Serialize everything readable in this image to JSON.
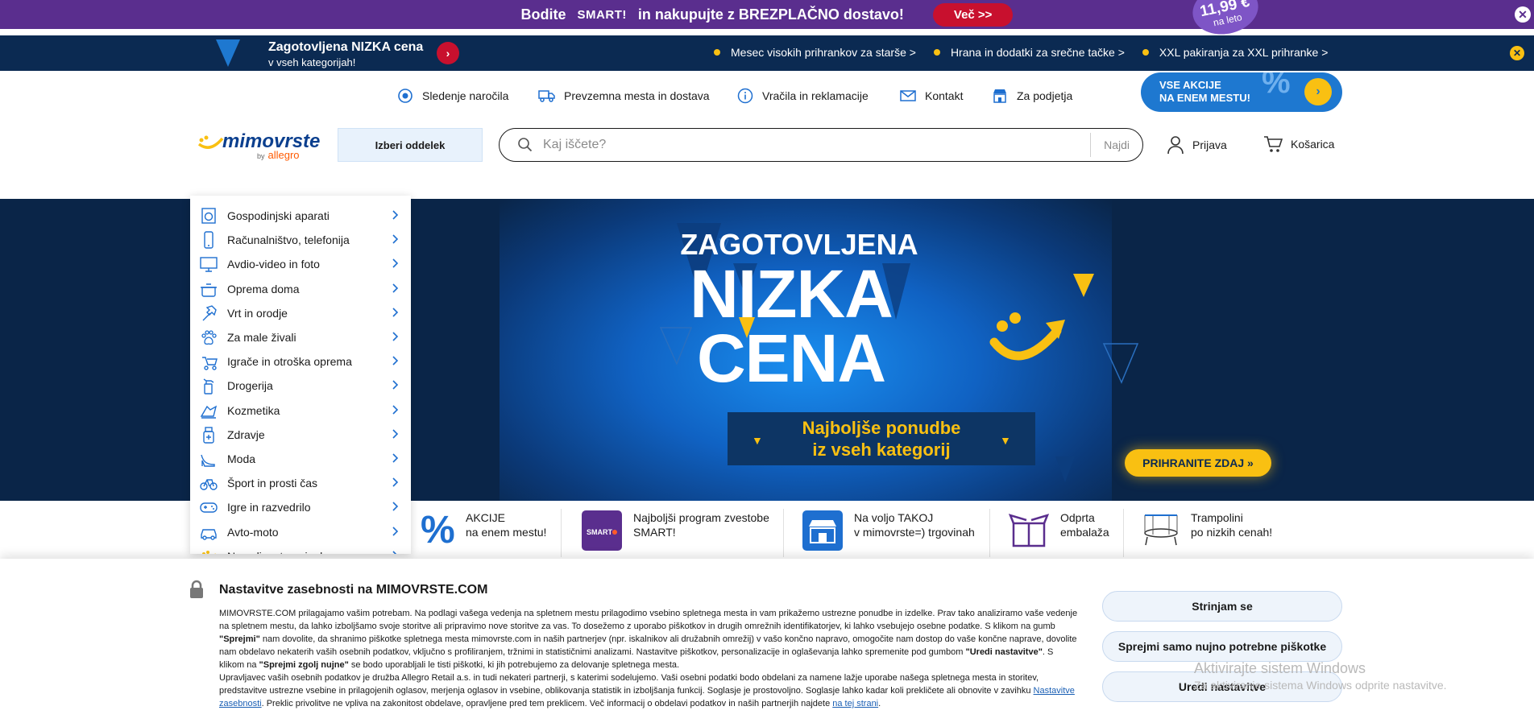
{
  "topbar": {
    "text_before": "Bodite",
    "smart_logo": "SMART!",
    "text_after": "in nakupujte z BREZPLAČNO dostavo!",
    "more_button": "Več >>",
    "badge_price": "11,99 €",
    "badge_sub": "na leto",
    "colors": {
      "background": "#5a2e8e",
      "button": "#c8102e"
    }
  },
  "secondary_bar": {
    "title": "Zagotovljena NIZKA cena",
    "subtitle": "v vseh kategorijah!",
    "links": [
      "Mesec visokih prihrankov za starše >",
      "Hrana in dodatki za srečne tačke >",
      "XXL pakiranja za XXL prihranke >"
    ],
    "colors": {
      "background": "#0b2a52",
      "bullet": "#f9c012"
    }
  },
  "utility_nav": [
    {
      "icon": "location-target-icon",
      "label": "Sledenje naročila"
    },
    {
      "icon": "truck-icon",
      "label": "Prevzemna mesta in dostava"
    },
    {
      "icon": "info-icon",
      "label": "Vračila in reklamacije"
    },
    {
      "icon": "envelope-icon",
      "label": "Kontakt"
    },
    {
      "icon": "shop-icon",
      "label": "Za podjetja"
    }
  ],
  "promo_pill": {
    "line1": "VSE AKCIJE",
    "line2": "NA ENEM MESTU!",
    "symbol": "%"
  },
  "header": {
    "logo_word": "mimovrste",
    "logo_by": "by",
    "logo_brand": "allegro",
    "department_button": "Izberi oddelek",
    "search_placeholder": "Kaj iščete?",
    "search_button": "Najdi",
    "login": "Prijava",
    "cart": "Košarica"
  },
  "categories": [
    {
      "icon": "washing-machine-icon",
      "label": "Gospodinjski aparati"
    },
    {
      "icon": "smartphone-icon",
      "label": "Računalništvo, telefonija"
    },
    {
      "icon": "monitor-icon",
      "label": "Avdio-video in foto"
    },
    {
      "icon": "pot-icon",
      "label": "Oprema doma"
    },
    {
      "icon": "hammer-icon",
      "label": "Vrt in orodje"
    },
    {
      "icon": "paw-icon",
      "label": "Za male živali"
    },
    {
      "icon": "stroller-icon",
      "label": "Igrače in otroška oprema"
    },
    {
      "icon": "spray-bottle-icon",
      "label": "Drogerija"
    },
    {
      "icon": "cosmetics-icon",
      "label": "Kozmetika"
    },
    {
      "icon": "medicine-icon",
      "label": "Zdravje"
    },
    {
      "icon": "high-heel-icon",
      "label": "Moda"
    },
    {
      "icon": "bicycle-icon",
      "label": "Šport in prosti čas"
    },
    {
      "icon": "gamepad-icon",
      "label": "Igre in razvedrilo"
    },
    {
      "icon": "car-icon",
      "label": "Avto-moto"
    },
    {
      "icon": "smile-icon",
      "label": "Na voljo v trgovinah"
    }
  ],
  "hero": {
    "line1": "ZAGOTOVLJENA",
    "line2": "NIZKA",
    "line3": "CENA",
    "box_line1": "Najboljše ponudbe",
    "box_line2": "iz vseh kategorij",
    "cta": "PRIHRANITE ZDAJ",
    "colors": {
      "background": "#0a2548",
      "accent": "#f9c012"
    }
  },
  "tiles": [
    {
      "icon": "percent-icon",
      "line1": "AKCIJE",
      "line2": "na enem mestu!"
    },
    {
      "icon": "smart-logo-icon",
      "line1": "Najboljši program zvestobe",
      "line2": "SMART!"
    },
    {
      "icon": "store-icon",
      "line1": "Na voljo TAKOJ",
      "line2": "v mimovrste=) trgovinah"
    },
    {
      "icon": "open-box-icon",
      "line1": "Odprta",
      "line2": "embalaža"
    },
    {
      "icon": "trampoline-icon",
      "line1": "Trampolini",
      "line2": "po nizkih cenah!"
    }
  ],
  "cookie": {
    "title": "Nastavitve zasebnosti na MIMOVRSTE.COM",
    "p1_a": "MIMOVRSTE.COM prilagajamo vašim potrebam. Na podlagi vašega vedenja na spletnem mestu prilagodimo vsebino spletnega mesta in vam prikažemo ustrezne ponudbe in izdelke. Prav tako analiziramo vaše vedenje na spletnem mestu, da lahko izboljšamo svoje storitve ali pripravimo nove storitve za vas. To dosežemo z uporabo piškotkov in drugih omrežnih identifikatorjev, ki lahko vsebujejo osebne podatke. S klikom na gumb ",
    "p1_b": "\"Sprejmi\"",
    "p1_c": " nam dovolite, da shranimo piškotke spletnega mesta mimovrste.com in naših partnerjev (npr. iskalnikov ali družabnih omrežij) v vašo končno napravo, omogočite nam dostop do vaše končne naprave, dovolite nam obdelavo nekaterih vaših osebnih podatkov, vključno s profiliranjem, tržnimi in statističnimi analizami. Nastavitve piškotkov, personalizacije in oglaševanja lahko spremenite pod gumbom ",
    "p1_d": "\"Uredi nastavitve\"",
    "p1_e": ". S klikom na ",
    "p1_f": "\"Sprejmi zgolj nujne\"",
    "p1_g": " se bodo uporabljali le tisti piškotki, ki jih potrebujemo za delovanje spletnega mesta.",
    "p2_a": "Upravljavec vaših osebnih podatkov je družba Allegro Retail a.s. in tudi nekateri partnerji, s katerimi sodelujemo. Vaši osebni podatki bodo obdelani za namene lažje uporabe našega spletnega mesta in storitev, predstavitve ustrezne vsebine in prilagojenih oglasov, merjenja oglasov in vsebine, oblikovanja statistik in izboljšanja funkcij. Soglasje je prostovoljno. Soglasje lahko kadar koli prekličete ali obnovite v zavihku ",
    "p2_link1": "Nastavitve zasebnosti",
    "p2_b": ". Preklic privolitve ne vpliva na zakonitost obdelave, opravljene pred tem preklicem. Več informacij o obdelavi podatkov in naših partnerjih najdete ",
    "p2_link2": "na tej strani",
    "p2_c": ".",
    "accept_all": "Strinjam se",
    "accept_necessary": "Sprejmi samo nujno potrebne piškotke",
    "edit_settings": "Uredi nastavitve"
  },
  "watermark": {
    "line1": "Aktivirajte sistem Windows",
    "line2": "Za aktiviranje sistema Windows odprite nastavitve."
  }
}
